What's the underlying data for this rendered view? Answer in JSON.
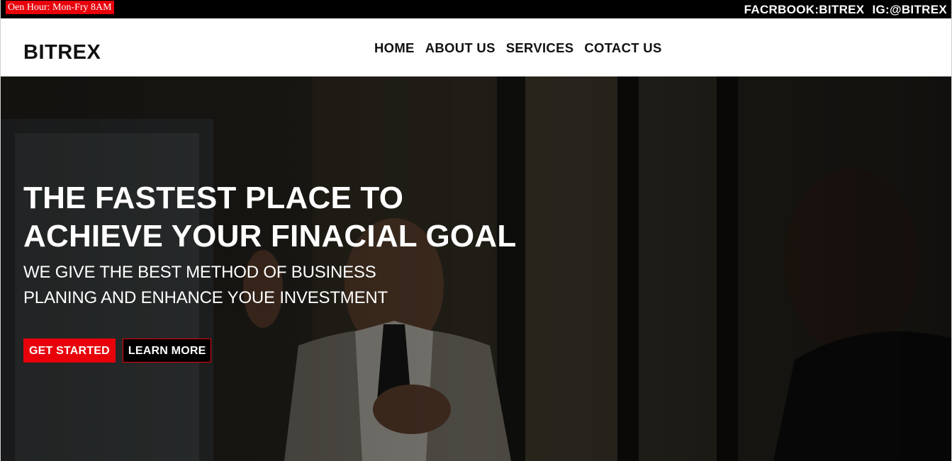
{
  "topbar": {
    "hours": "Oen Hour: Mon-Fry 8AM",
    "facebook": "FACRBOOK:BITREX",
    "instagram": "IG:@BITREX"
  },
  "header": {
    "logo": "BITREX",
    "nav": [
      "HOME",
      "ABOUT US",
      "SERVICES",
      "COTACT US"
    ]
  },
  "hero": {
    "headline_line1": "THE FASTEST PLACE TO",
    "headline_line2": "ACHIEVE YOUR FINACIAL GOAL",
    "subline_line1": "WE GIVE THE BEST METHOD OF BUSINESS",
    "subline_line2": "PLANING AND ENHANCE YOUE INVESTMENT",
    "primary_button": "GET STARTED",
    "secondary_button": "LEARN MORE"
  },
  "colors": {
    "accent": "#e8000b",
    "topbar_bg": "#000000",
    "header_bg": "#ffffff"
  }
}
